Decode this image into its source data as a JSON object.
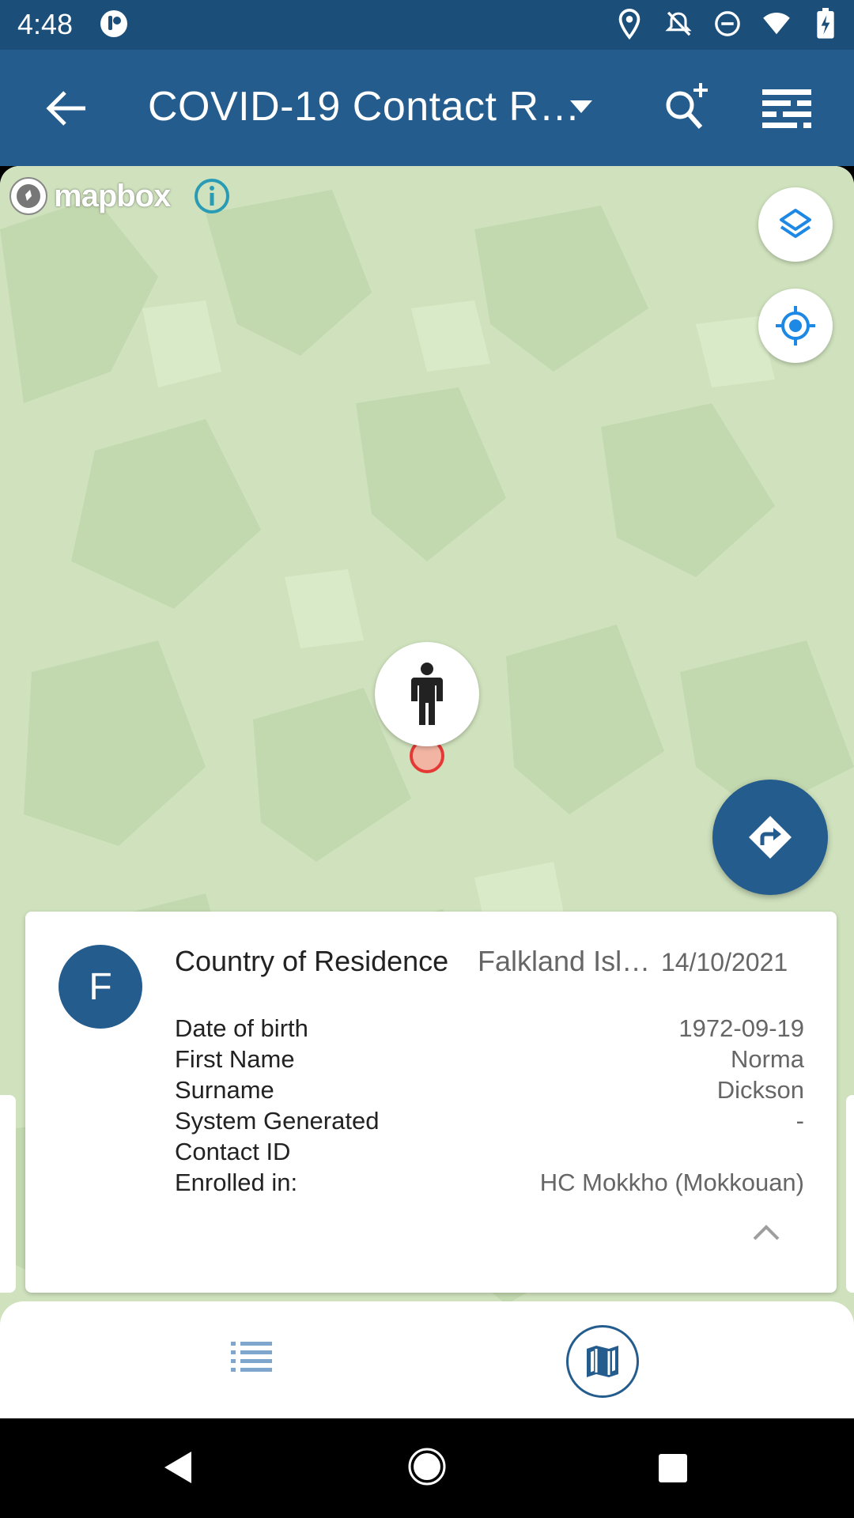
{
  "status_bar": {
    "time": "4:48",
    "icons": [
      "app-notification-icon",
      "location-icon",
      "notifications-off-icon",
      "do-not-disturb-icon",
      "wifi-icon",
      "battery-charging-icon"
    ]
  },
  "app_bar": {
    "title": "COVID-19 Contact R…",
    "back_icon": "arrow-left-icon",
    "dropdown_icon": "caret-down-icon",
    "search_icon": "search-add-icon",
    "filter_icon": "filter-list-icon",
    "background": "#235c8d"
  },
  "map": {
    "attribution": "mapbox",
    "info_icon": "info-icon",
    "layers_icon": "layers-icon",
    "locate_icon": "my-location-icon",
    "marker_icon": "person-icon",
    "directions_icon": "directions-icon",
    "background": "#cfe2bd"
  },
  "card": {
    "avatar_letter": "F",
    "title": "Country of Residence",
    "title_value": "Falkland Isl…",
    "date": "14/10/2021",
    "attributes": [
      {
        "label": "Date of birth",
        "value": "1972-09-19"
      },
      {
        "label": "First Name",
        "value": "Norma"
      },
      {
        "label": "Surname",
        "value": "Dickson"
      },
      {
        "label": "System Generated",
        "value": "-"
      },
      {
        "label": "Contact ID",
        "value": ""
      },
      {
        "label": "Enrolled in:",
        "value": "HC Mokkho (Mokkouan)"
      }
    ],
    "collapse_icon": "chevron-up-icon"
  },
  "bottom_nav": {
    "list_icon": "list-icon",
    "map_icon": "map-icon",
    "active": "map"
  },
  "system_nav": {
    "back_icon": "triangle-back-icon",
    "home_icon": "circle-home-icon",
    "recents_icon": "square-recents-icon"
  }
}
